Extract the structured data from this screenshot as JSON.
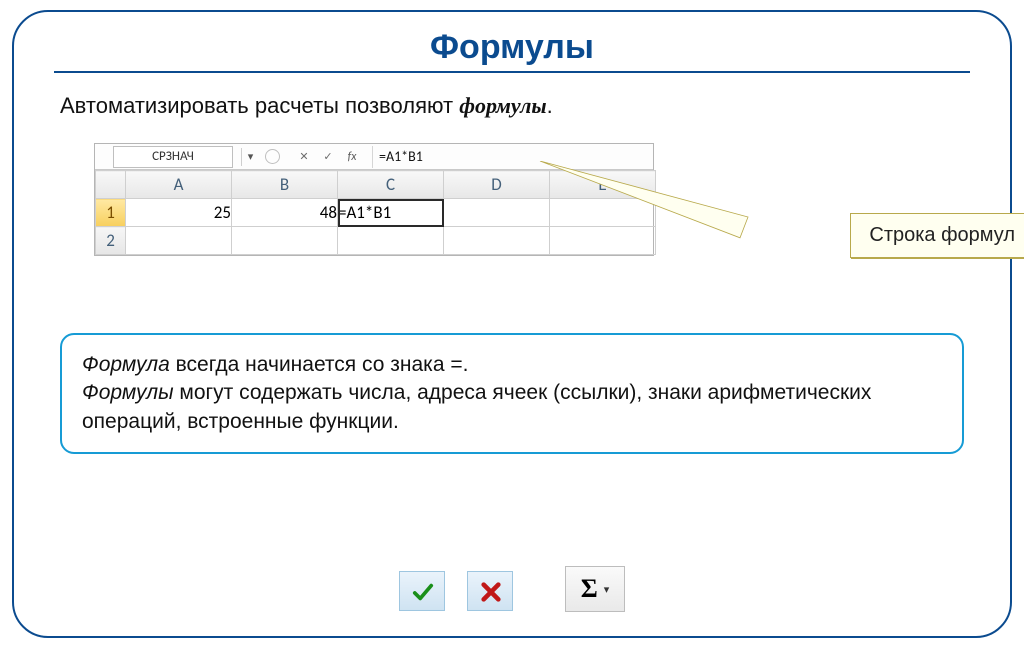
{
  "title": "Формулы",
  "intro": {
    "prefix": "Автоматизировать расчеты позволяют ",
    "emph": "формулы",
    "suffix": "."
  },
  "namebox": "СРЗНАЧ",
  "formula_bar_value": "=A1*B1",
  "columns": [
    "A",
    "B",
    "C",
    "D",
    "E"
  ],
  "selected_column": "C",
  "rows": [
    {
      "num": "1",
      "selected": true,
      "cells": [
        "25",
        "48",
        "=A1*B1",
        "",
        ""
      ]
    },
    {
      "num": "2",
      "selected": false,
      "cells": [
        "",
        "",
        "",
        "",
        ""
      ]
    }
  ],
  "active_cell": "C1",
  "callout_label": "Строка формул",
  "info": {
    "term": "Формула",
    "line1_rest": " всегда начинается со знака =.",
    "line2_prefix": "Формулы",
    "line2_rest": " могут содержать числа, адреса ячеек (ссылки), знаки арифметических операций, встроенные функции."
  },
  "icons": {
    "fx": "fx",
    "sigma": "Σ"
  }
}
